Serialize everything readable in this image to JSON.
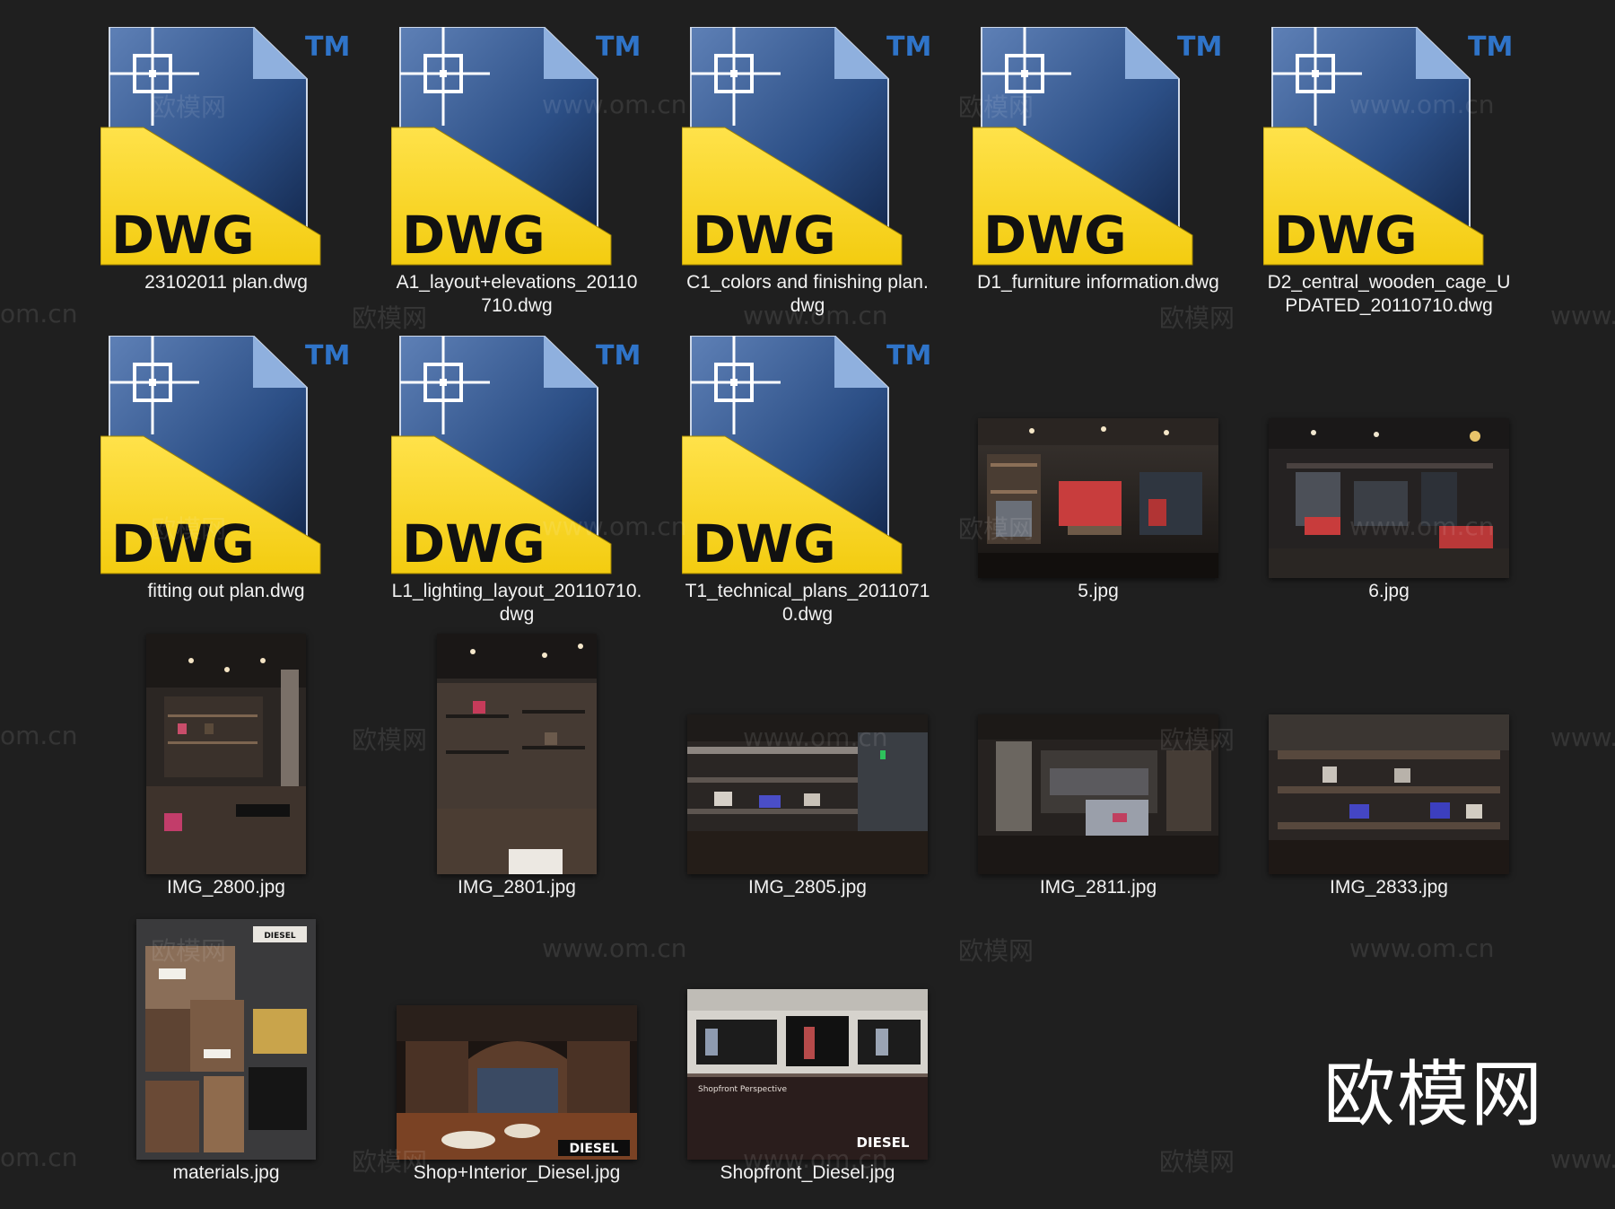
{
  "files": [
    {
      "name": "23102011 plan.dwg",
      "type": "dwg",
      "icon": "dwg-file-icon"
    },
    {
      "name": "A1_layout+elevations_20110710.dwg",
      "type": "dwg",
      "icon": "dwg-file-icon"
    },
    {
      "name": "C1_colors and finishing plan.dwg",
      "type": "dwg",
      "icon": "dwg-file-icon"
    },
    {
      "name": "D1_furniture information.dwg",
      "type": "dwg",
      "icon": "dwg-file-icon"
    },
    {
      "name": "D2_central_wooden_cage_UPDATED_20110710.dwg",
      "type": "dwg",
      "icon": "dwg-file-icon"
    },
    {
      "name": "fitting out plan.dwg",
      "type": "dwg",
      "icon": "dwg-file-icon"
    },
    {
      "name": "L1_lighting_layout_20110710.dwg",
      "type": "dwg",
      "icon": "dwg-file-icon"
    },
    {
      "name": "T1_technical_plans_20110710.dwg",
      "type": "dwg",
      "icon": "dwg-file-icon"
    },
    {
      "name": "5.jpg",
      "type": "jpg",
      "icon": "store-interior-photo"
    },
    {
      "name": "6.jpg",
      "type": "jpg",
      "icon": "store-interior-photo"
    },
    {
      "name": "IMG_2800.jpg",
      "type": "jpg",
      "icon": "store-interior-photo"
    },
    {
      "name": "IMG_2801.jpg",
      "type": "jpg",
      "icon": "store-interior-photo"
    },
    {
      "name": "IMG_2805.jpg",
      "type": "jpg",
      "icon": "store-interior-photo"
    },
    {
      "name": "IMG_2811.jpg",
      "type": "jpg",
      "icon": "store-interior-photo"
    },
    {
      "name": "IMG_2833.jpg",
      "type": "jpg",
      "icon": "store-interior-photo"
    },
    {
      "name": "materials.jpg",
      "type": "jpg",
      "icon": "material-board-photo"
    },
    {
      "name": "Shop+Interior_Diesel.jpg",
      "type": "jpg",
      "icon": "store-render-photo"
    },
    {
      "name": "Shopfront_Diesel.jpg",
      "type": "jpg",
      "icon": "shopfront-render-photo"
    }
  ],
  "dwg_icon": {
    "label": "DWG",
    "trademark": "TM"
  },
  "photo_text": {
    "diesel_brand": "DIESEL",
    "shopfront_caption": "Shopfront Perspective"
  },
  "watermarks": {
    "site": "www.om.cn",
    "site_short": "om.cn",
    "site_cut": "www.",
    "cn": "欧模网",
    "logo": "欧模网"
  },
  "colors": {
    "background": "#1f1f1f",
    "dwg_yellow": "#f3cc10",
    "dwg_blue": "#2c4f86"
  }
}
